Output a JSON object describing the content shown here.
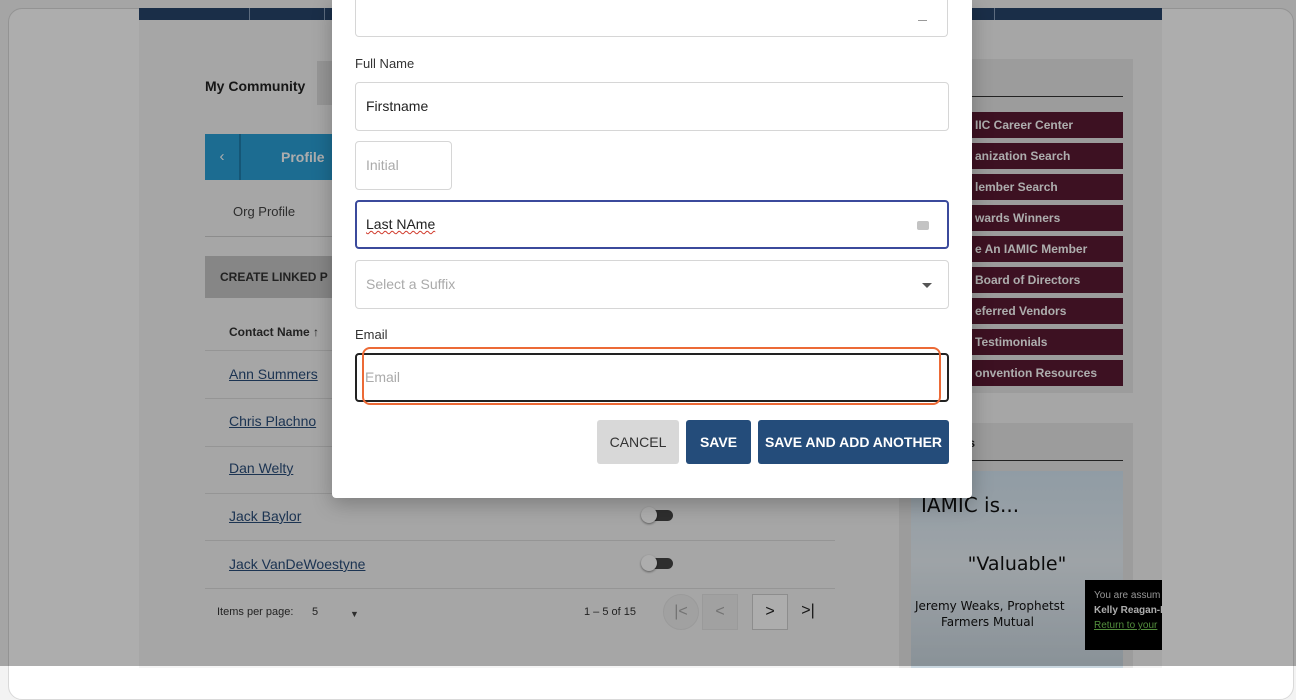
{
  "background": {
    "community_title": "My Community",
    "profile_tab": {
      "back_icon": "chevron-left-icon",
      "label": "Profile"
    },
    "org_profile_tab": "Org Profile",
    "create_linked_button": "CREATE LINKED P",
    "table": {
      "column_header": "Contact Name ↑",
      "rows": [
        {
          "name": "Ann Summers"
        },
        {
          "name": "Chris Plachno"
        },
        {
          "name": "Dan Welty"
        },
        {
          "name": "Jack Baylor"
        },
        {
          "name": "Jack VanDeWoestyne"
        }
      ]
    },
    "paginator": {
      "items_per_page_label": "Items per page:",
      "items_per_page_value": "5",
      "range_label": "1 – 5 of 15",
      "first_icon": "|<",
      "prev_icon": "<",
      "next_icon": ">",
      "last_icon": ">|"
    }
  },
  "sidebar": {
    "box1_heading": "s",
    "links": [
      "IIC Career Center",
      "anization Search",
      "lember Search",
      "wards Winners",
      "e An IAMIC Member",
      "Board of Directors",
      "eferred Vendors",
      "Testimonials",
      "onvention Resources"
    ],
    "box2_heading": "ls",
    "promo": {
      "line1": "IAMIC is...",
      "line2": "\"Valuable\"",
      "line3": "Jeremy Weaks, Prophetst",
      "line4": "Farmers Mutual"
    }
  },
  "toast": {
    "line1": "You are assum",
    "line2": "Kelly Reagan-F",
    "line3": "Return to your"
  },
  "modal": {
    "full_name_label": "Full Name",
    "first_name_value": "Firstname",
    "initial_placeholder": "Initial",
    "last_name_value": "Last NAme",
    "suffix_placeholder": "Select a Suffix",
    "email_label": "Email",
    "email_placeholder": "Email",
    "buttons": {
      "cancel": "CANCEL",
      "save": "SAVE",
      "save_and_add": "SAVE AND ADD ANOTHER"
    }
  },
  "colors": {
    "accent_blue": "#2a9fd6",
    "navy": "#244c7a",
    "sidebar_maroon": "#5a1a33",
    "highlight_orange": "#ec6a36",
    "focus_border": "#3b4a9c"
  }
}
